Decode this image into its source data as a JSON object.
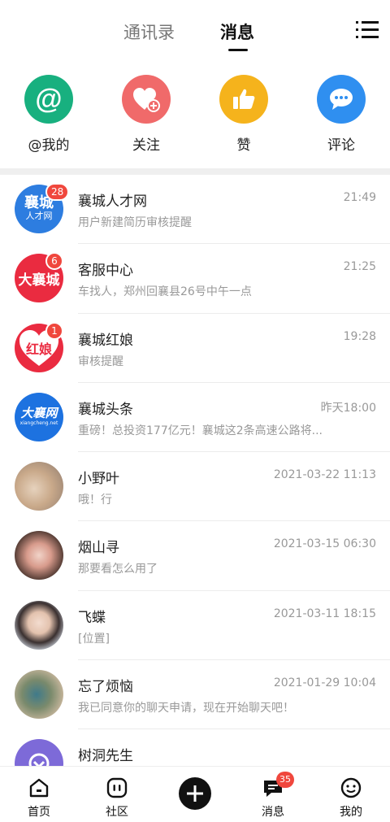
{
  "header": {
    "tab_contacts": "通讯录",
    "tab_messages": "消息"
  },
  "quick_actions": [
    {
      "label": "@我的",
      "icon": "at-icon",
      "color": "#18b07f"
    },
    {
      "label": "关注",
      "icon": "heart-plus-icon",
      "color": "#f06a6a"
    },
    {
      "label": "赞",
      "icon": "thumbs-up-icon",
      "color": "#f5b31c"
    },
    {
      "label": "评论",
      "icon": "comment-bubble-icon",
      "color": "#2f8ff0"
    }
  ],
  "conversations": [
    {
      "name": "襄城人才网",
      "time": "21:49",
      "preview": "用户新建简历审核提醒",
      "badge": "28",
      "avatar_text": "襄城",
      "avatar_sub": "人才网",
      "avatar_color": "#2d7de0"
    },
    {
      "name": "客服中心",
      "time": "21:25",
      "preview": "车找人，郑州回襄县26号中午一点",
      "badge": "6",
      "avatar_text": "大襄城",
      "avatar_color": "#ea2b40"
    },
    {
      "name": "襄城红娘",
      "time": "19:28",
      "preview": "审核提醒",
      "badge": "1",
      "avatar_text": "红娘",
      "avatar_color": "#ea2b40"
    },
    {
      "name": "襄城头条",
      "time": "昨天18:00",
      "preview": "重磅！总投资177亿元！襄城这2条高速公路将...",
      "avatar_text": "大襄网",
      "avatar_sub": "xiangcheng.net",
      "avatar_color": "#1d72e0"
    },
    {
      "name": "小野叶",
      "time": "2021-03-22 11:13",
      "preview": "哦！行",
      "avatar_color": "#c9a98a"
    },
    {
      "name": "烟山寻",
      "time": "2021-03-15 06:30",
      "preview": "那要看怎么用了",
      "avatar_color": "#5a4038"
    },
    {
      "name": "飞蝶",
      "time": "2021-03-11 18:15",
      "preview": "[位置]",
      "avatar_color": "#cfd6e0"
    },
    {
      "name": "忘了烦恼",
      "time": "2021-01-29 10:04",
      "preview": "我已同意你的聊天申请，现在开始聊天吧！",
      "avatar_color": "#7a8a6c"
    },
    {
      "name": "树洞先生",
      "time": "",
      "preview": "",
      "avatar_color": "#7d6ad8"
    }
  ],
  "bottom_nav": {
    "home": "首页",
    "community": "社区",
    "messages": "消息",
    "messages_badge": "35",
    "mine": "我的"
  }
}
